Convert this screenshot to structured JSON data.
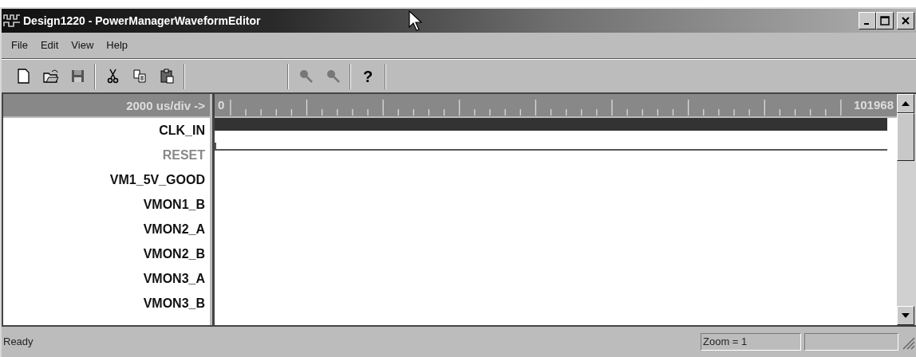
{
  "window": {
    "title": "Design1220 - PowerManagerWaveformEditor"
  },
  "menu": [
    {
      "label": "File"
    },
    {
      "label": "Edit"
    },
    {
      "label": "View"
    },
    {
      "label": "Help"
    }
  ],
  "toolbar": [
    {
      "kind": "new"
    },
    {
      "kind": "open"
    },
    {
      "kind": "save"
    },
    {
      "kind": "sep"
    },
    {
      "kind": "cut"
    },
    {
      "kind": "copy"
    },
    {
      "kind": "paste"
    },
    {
      "kind": "sep"
    },
    {
      "kind": "gap"
    },
    {
      "kind": "sep"
    },
    {
      "kind": "zoomin"
    },
    {
      "kind": "zoomout"
    },
    {
      "kind": "sep"
    },
    {
      "kind": "help",
      "label": "?"
    },
    {
      "kind": "sep"
    }
  ],
  "scale": {
    "label": "2000 us/div ->",
    "start": "0",
    "end": "101968"
  },
  "signals": [
    {
      "name": "CLK_IN",
      "disabled": false,
      "kind": "clock"
    },
    {
      "name": "RESET",
      "disabled": true,
      "kind": "low"
    },
    {
      "name": "VM1_5V_GOOD",
      "disabled": false,
      "kind": "empty"
    },
    {
      "name": "VMON1_B",
      "disabled": false,
      "kind": "empty"
    },
    {
      "name": "VMON2_A",
      "disabled": false,
      "kind": "empty"
    },
    {
      "name": "VMON2_B",
      "disabled": false,
      "kind": "empty"
    },
    {
      "name": "VMON3_A",
      "disabled": false,
      "kind": "empty"
    },
    {
      "name": "VMON3_B",
      "disabled": false,
      "kind": "empty"
    }
  ],
  "status_bar": {
    "message": "Ready",
    "zoom": "Zoom = 1"
  }
}
